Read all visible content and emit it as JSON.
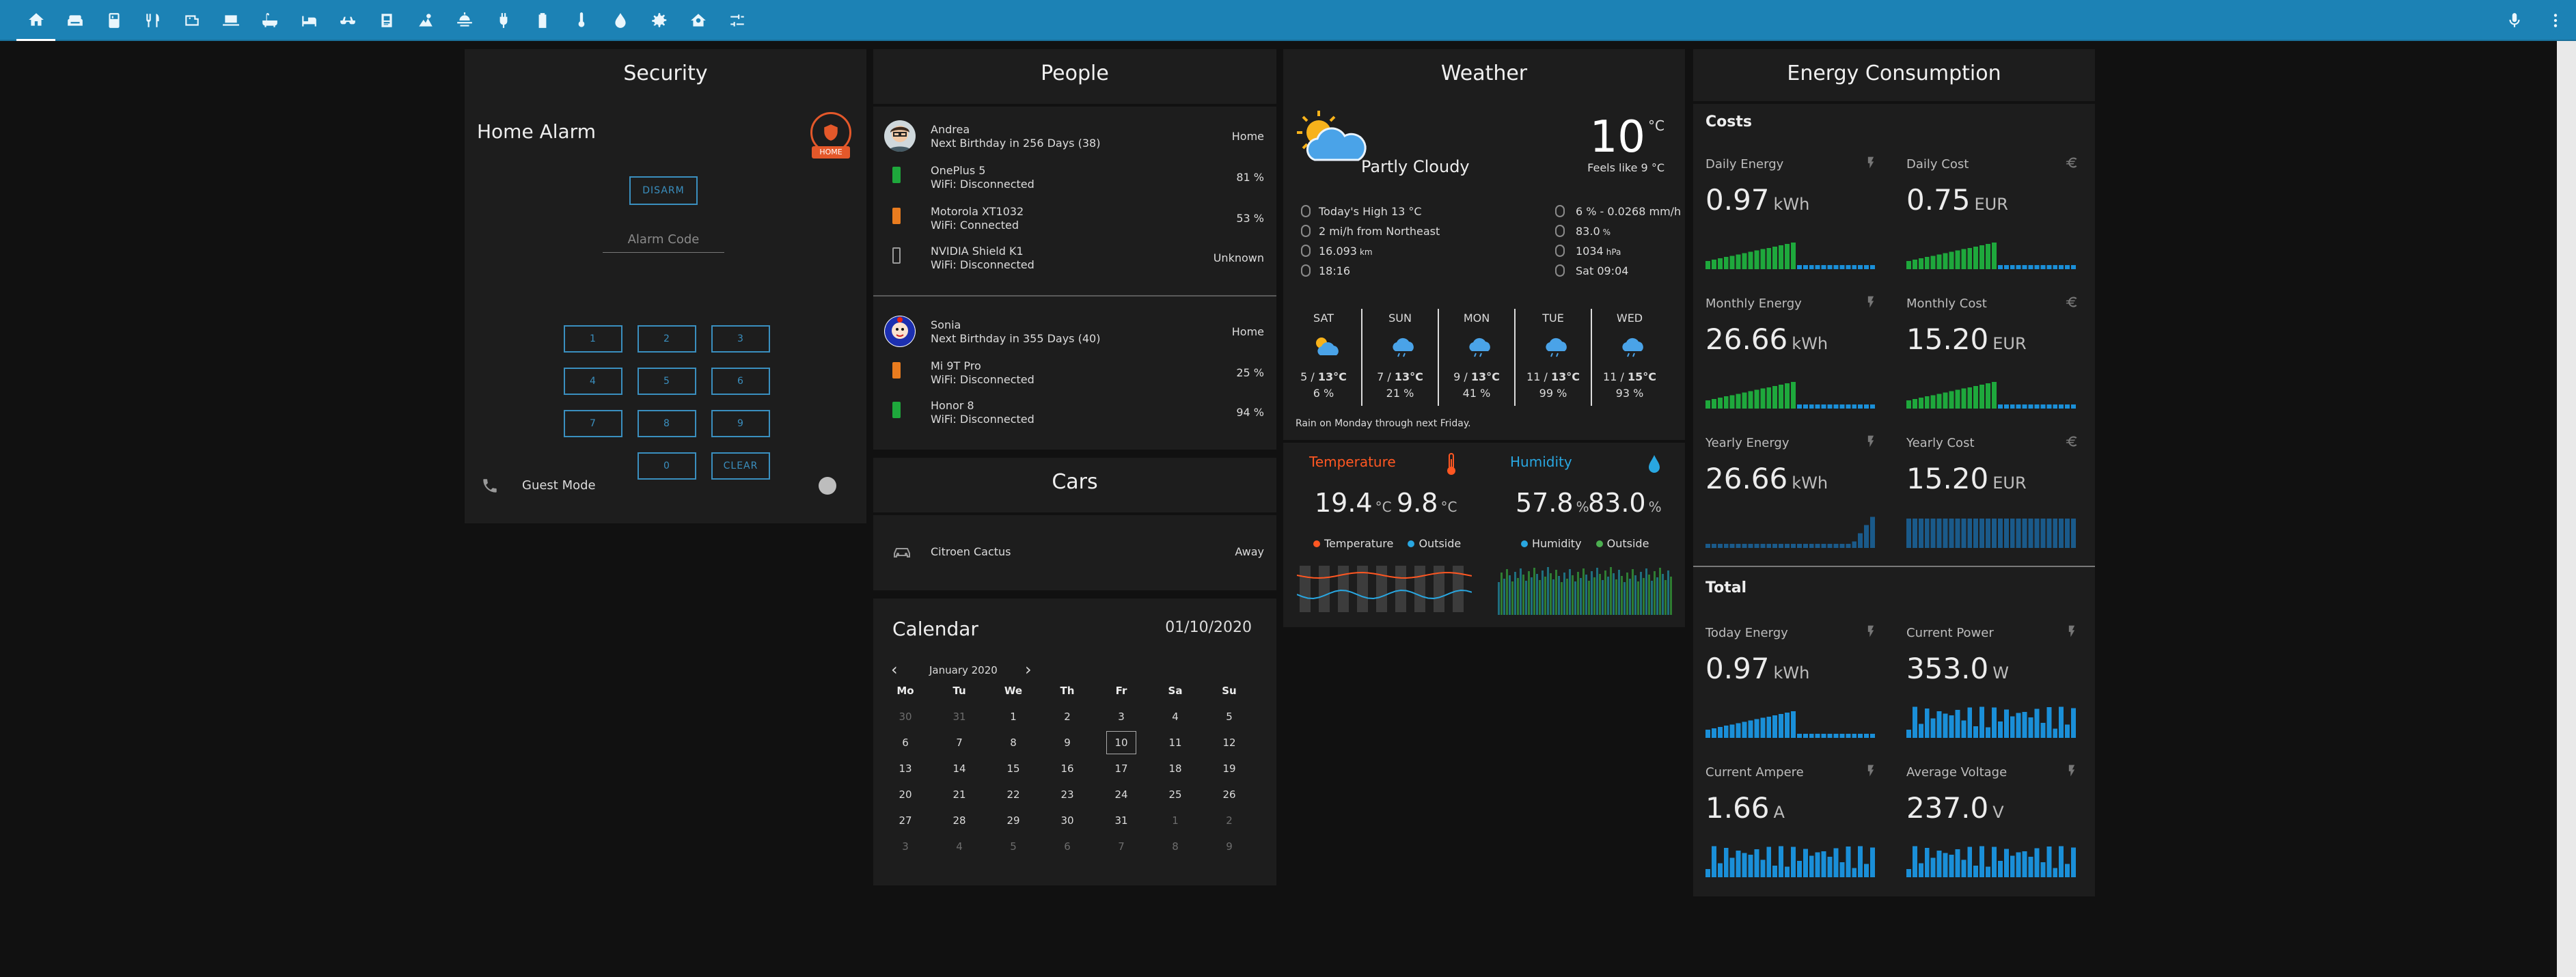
{
  "colors": {
    "topbar": "#1c82b5",
    "card": "#1d1d1d",
    "bg": "#111111",
    "accent_blue": "#2a9ad9",
    "bar_green": "#1ea83c",
    "bar_blue": "#1a8fd8",
    "temp_orange": "#ff5722",
    "humidity_blue": "#29a7e1",
    "alarm_orange": "#e4582a"
  },
  "nav": {
    "icons": [
      "home-icon",
      "sofa-icon",
      "fridge-icon",
      "kitchen-icon",
      "washing-machine-icon",
      "laptop-icon",
      "bathtub-icon",
      "bed-icon",
      "glasses-icon",
      "id-card-icon",
      "garden-icon",
      "weather-sunset-icon",
      "plug-icon",
      "battery-icon",
      "thermometer-icon",
      "water-icon",
      "settings-icon",
      "home-automation-icon",
      "sliders-icon"
    ],
    "right_icons": [
      "microphone-icon",
      "more-vert-icon"
    ]
  },
  "security": {
    "title": "Security",
    "alarm_title": "Home Alarm",
    "alarm_badge": "HOME",
    "disarm": "DISARM",
    "code_placeholder": "Alarm Code",
    "keys": [
      "1",
      "2",
      "3",
      "4",
      "5",
      "6",
      "7",
      "8",
      "9",
      "0",
      "CLEAR"
    ],
    "guest_mode": "Guest Mode"
  },
  "people": {
    "title": "People",
    "persons": [
      {
        "name": "Andrea",
        "birthday": "Next Birthday in 256 Days (38)",
        "state": "Home",
        "devices": [
          {
            "name": "OnePlus 5",
            "wifi": "WiFi: Disconnected",
            "value": "81 %"
          },
          {
            "name": "Motorola XT1032",
            "wifi": "WiFi: Connected",
            "value": "53 %"
          },
          {
            "name": "NVIDIA Shield K1",
            "wifi": "WiFi: Disconnected",
            "value": "Unknown"
          }
        ]
      },
      {
        "name": "Sonia",
        "birthday": "Next Birthday in 355 Days (40)",
        "state": "Home",
        "devices": [
          {
            "name": "Mi 9T Pro",
            "wifi": "WiFi: Disconnected",
            "value": "25 %"
          },
          {
            "name": "Honor 8",
            "wifi": "WiFi: Disconnected",
            "value": "94 %"
          }
        ]
      }
    ]
  },
  "cars": {
    "title": "Cars",
    "name": "Citroen Cactus",
    "state": "Away"
  },
  "calendar": {
    "title": "Calendar",
    "date": "01/10/2020",
    "month": "January 2020",
    "prev": "‹",
    "next": "›",
    "headers": [
      "Mo",
      "Tu",
      "We",
      "Th",
      "Fr",
      "Sa",
      "Su"
    ],
    "weeks": [
      [
        "30",
        "31",
        "1",
        "2",
        "3",
        "4",
        "5"
      ],
      [
        "6",
        "7",
        "8",
        "9",
        "10",
        "11",
        "12"
      ],
      [
        "13",
        "14",
        "15",
        "16",
        "17",
        "18",
        "19"
      ],
      [
        "20",
        "21",
        "22",
        "23",
        "24",
        "25",
        "26"
      ],
      [
        "27",
        "28",
        "29",
        "30",
        "31",
        "1",
        "2"
      ],
      [
        "3",
        "4",
        "5",
        "6",
        "7",
        "8",
        "9"
      ]
    ]
  },
  "weather": {
    "title": "Weather",
    "condition": "Partly Cloudy",
    "temp": "10",
    "temp_unit": "°C",
    "feels_like": "Feels like 9 °C",
    "left": [
      {
        "icon": "thermometer-icon",
        "text": "Today's High 13 °C"
      },
      {
        "icon": "wind-icon",
        "text": "2 mi/h from Northeast"
      },
      {
        "icon": "visibility-icon",
        "text": "16.093",
        "unit": "km"
      },
      {
        "icon": "sunset-icon",
        "text": "18:16"
      }
    ],
    "right": [
      {
        "icon": "rain-icon",
        "text": "6 % - 0.0268 mm/h"
      },
      {
        "icon": "humidity-icon",
        "text": "83.0",
        "unit": "%"
      },
      {
        "icon": "pressure-icon",
        "text": "1034",
        "unit": "hPa"
      },
      {
        "icon": "sunrise-icon",
        "text": "Sat 09:04"
      }
    ],
    "forecast": [
      {
        "day": "SAT",
        "lo": "5",
        "hi": "13°C",
        "rain": "6 %"
      },
      {
        "day": "SUN",
        "lo": "7",
        "hi": "13°C",
        "rain": "21 %"
      },
      {
        "day": "MON",
        "lo": "9",
        "hi": "13°C",
        "rain": "41 %"
      },
      {
        "day": "TUE",
        "lo": "11",
        "hi": "13°C",
        "rain": "99 %"
      },
      {
        "day": "WED",
        "lo": "11",
        "hi": "15°C",
        "rain": "93 %"
      }
    ],
    "summary": "Rain on Monday through next Friday.",
    "temperature": {
      "label": "Temperature",
      "inside": "19.4",
      "outside": "9.8",
      "unit": "°C",
      "legend": [
        "Temperature",
        "Outside"
      ]
    },
    "humidity": {
      "label": "Humidity",
      "inside": "57.8",
      "outside": "83.0",
      "unit": "%",
      "legend": [
        "Humidity",
        "Outside"
      ]
    }
  },
  "energy": {
    "title": "Energy Consumption",
    "costs_title": "Costs",
    "total_title": "Total",
    "costs": [
      {
        "label": "Daily Energy",
        "value": "0.97",
        "unit": "kWh",
        "color": "green",
        "icon": "flash-icon"
      },
      {
        "label": "Daily Cost",
        "value": "0.75",
        "unit": "EUR",
        "color": "green",
        "icon": "euro-icon"
      },
      {
        "label": "Monthly Energy",
        "value": "26.66",
        "unit": "kWh",
        "color": "green",
        "icon": "flash-icon"
      },
      {
        "label": "Monthly Cost",
        "value": "15.20",
        "unit": "EUR",
        "color": "green",
        "icon": "euro-icon"
      },
      {
        "label": "Yearly Energy",
        "value": "26.66",
        "unit": "kWh",
        "color": "blue",
        "icon": "flash-icon"
      },
      {
        "label": "Yearly Cost",
        "value": "15.20",
        "unit": "EUR",
        "color": "blue",
        "icon": "euro-icon"
      }
    ],
    "total": [
      {
        "label": "Today Energy",
        "value": "0.97",
        "unit": "kWh",
        "icon": "flash-icon"
      },
      {
        "label": "Current Power",
        "value": "353.0",
        "unit": "W",
        "icon": "flash-icon"
      },
      {
        "label": "Current Ampere",
        "value": "1.66",
        "unit": "A",
        "icon": "flash-icon"
      },
      {
        "label": "Average Voltage",
        "value": "237.0",
        "unit": "V",
        "icon": "flash-icon"
      }
    ]
  }
}
